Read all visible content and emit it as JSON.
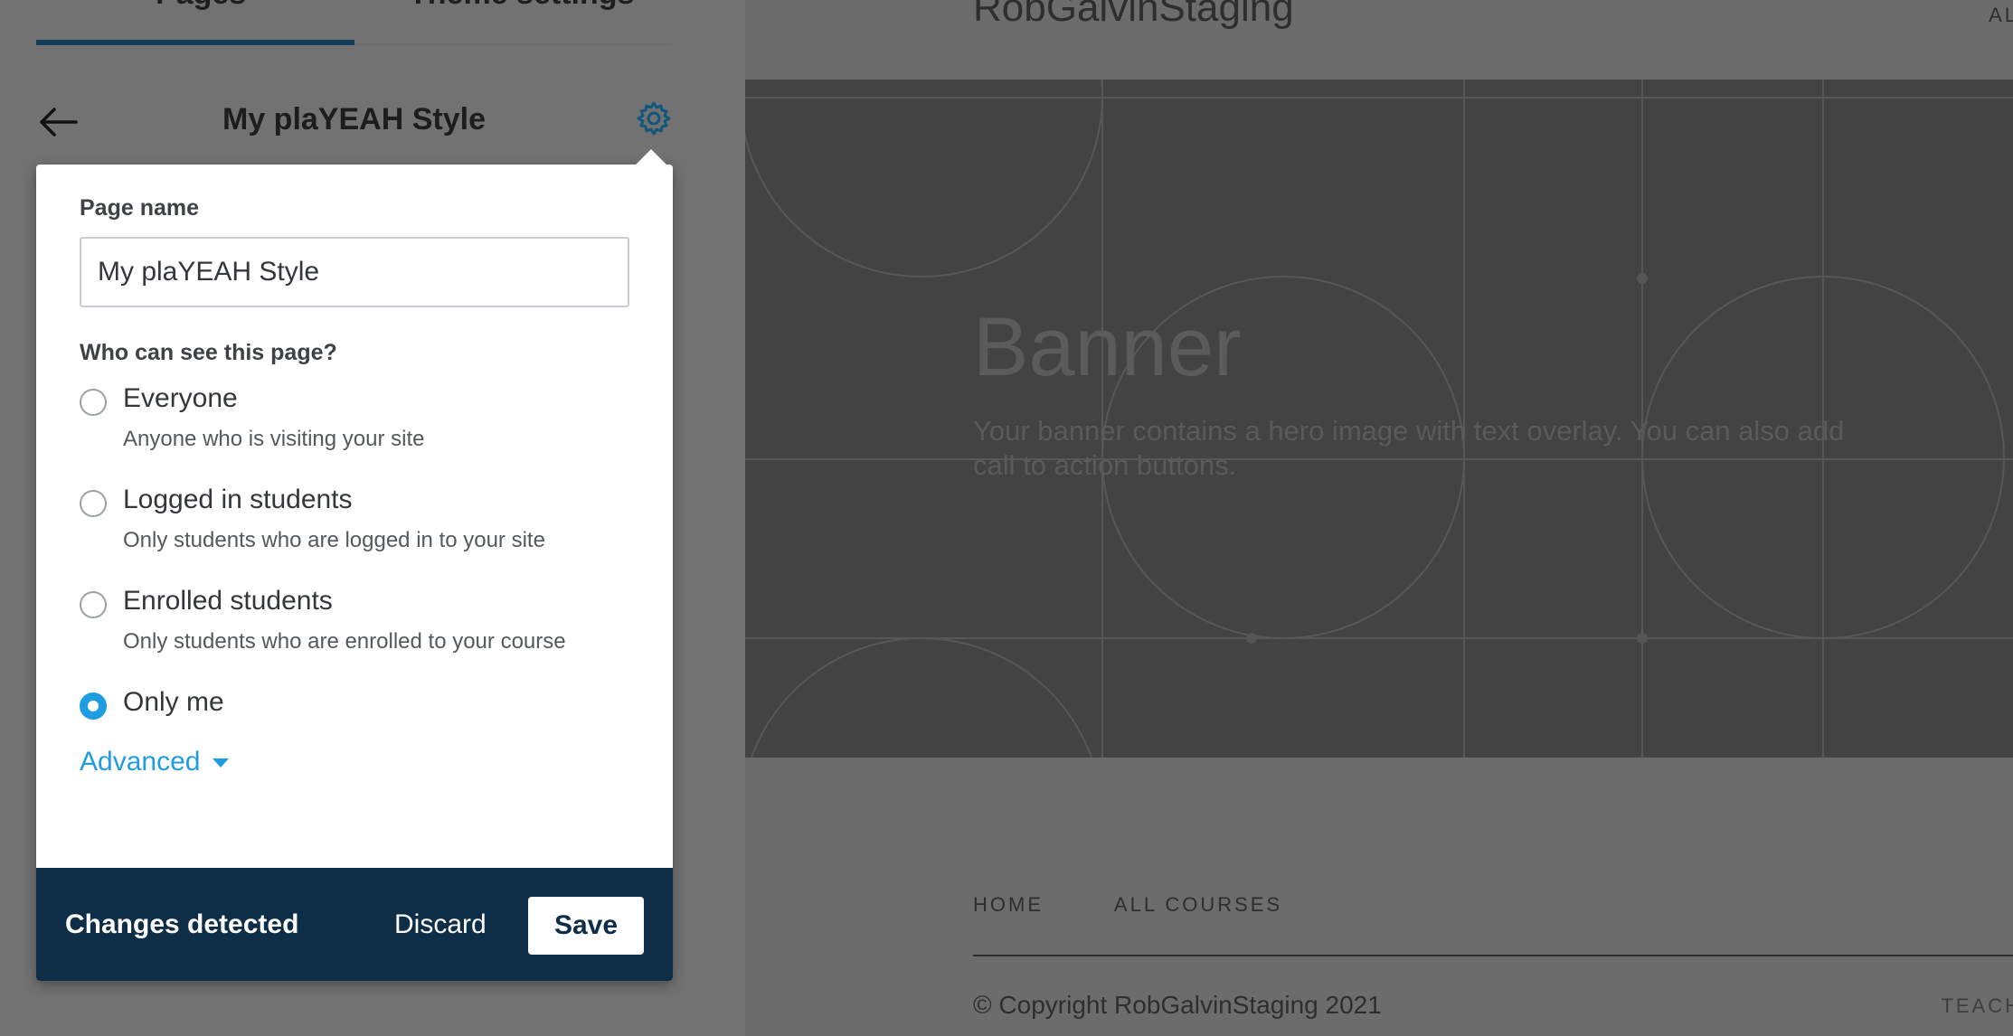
{
  "tabs": {
    "pages": "Pages",
    "theme_settings": "Theme settings"
  },
  "panel": {
    "title": "My plaYEAH Style"
  },
  "popup": {
    "page_name_label": "Page name",
    "page_name_value": "My plaYEAH Style",
    "visibility_label": "Who can see this page?",
    "options": [
      {
        "title": "Everyone",
        "desc": "Anyone who is visiting your site",
        "selected": false
      },
      {
        "title": "Logged in students",
        "desc": "Only students who are logged in to your site",
        "selected": false
      },
      {
        "title": "Enrolled students",
        "desc": "Only students who are enrolled to your course",
        "selected": false
      },
      {
        "title": "Only me",
        "desc": "",
        "selected": true
      }
    ],
    "advanced_label": "Advanced",
    "footer": {
      "status": "Changes detected",
      "discard": "Discard",
      "save": "Save"
    }
  },
  "preview": {
    "site_name": "RobGalvinStaging",
    "nav_right": "AL",
    "banner_title": "Banner",
    "banner_text": "Your banner contains a hero image with text overlay. You can also add call to action buttons.",
    "footer_nav": [
      "HOME",
      "ALL COURSES"
    ],
    "copyright": "© Copyright RobGalvinStaging 2021",
    "footer_right": "TEACH"
  },
  "colors": {
    "accent": "#1f9de0",
    "footer_bg": "#0e2d47",
    "tab_underline": "#1f6fa5"
  }
}
